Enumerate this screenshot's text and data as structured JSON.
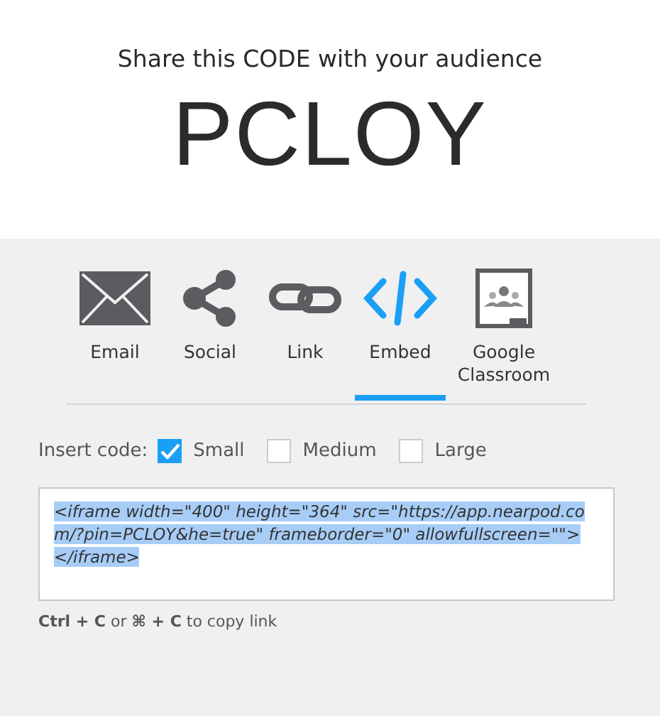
{
  "header": {
    "prompt": "Share this CODE with your audience",
    "code": "PCLOY"
  },
  "share_tabs": [
    {
      "kind": "email",
      "label": "Email",
      "selected": false
    },
    {
      "kind": "social",
      "label": "Social",
      "selected": false
    },
    {
      "kind": "link",
      "label": "Link",
      "selected": false
    },
    {
      "kind": "embed",
      "label": "Embed",
      "selected": true
    },
    {
      "kind": "classroom",
      "label": "Google Classroom",
      "selected": false
    }
  ],
  "insert_code": {
    "label": "Insert code:",
    "options": [
      {
        "label": "Small",
        "checked": true
      },
      {
        "label": "Medium",
        "checked": false
      },
      {
        "label": "Large",
        "checked": false
      }
    ]
  },
  "embed_code": "<iframe width=\"400\" height=\"364\" src=\"https://app.nearpod.com/?pin=PCLOY&he=true\" frameborder=\"0\" allowfullscreen=\"\"></iframe>",
  "hint": "**Ctrl + C** or **⌘ + C** to copy link"
}
